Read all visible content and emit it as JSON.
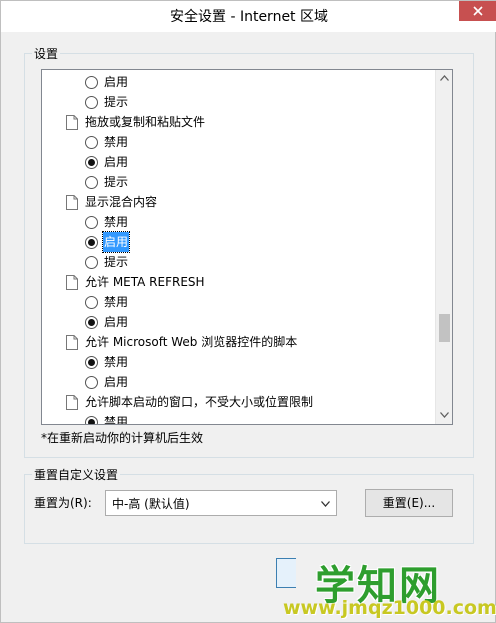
{
  "window": {
    "title": "安全设置 - Internet 区域"
  },
  "settings_group": {
    "label": "设置"
  },
  "list": [
    {
      "kind": "option",
      "label": "启用",
      "checked": false
    },
    {
      "kind": "option",
      "label": "提示",
      "checked": false
    },
    {
      "kind": "header",
      "label": "拖放或复制和粘贴文件"
    },
    {
      "kind": "option",
      "label": "禁用",
      "checked": false
    },
    {
      "kind": "option",
      "label": "启用",
      "checked": true
    },
    {
      "kind": "option",
      "label": "提示",
      "checked": false
    },
    {
      "kind": "header",
      "label": "显示混合内容"
    },
    {
      "kind": "option",
      "label": "禁用",
      "checked": false
    },
    {
      "kind": "option",
      "label": "启用",
      "checked": true,
      "selected": true
    },
    {
      "kind": "option",
      "label": "提示",
      "checked": false
    },
    {
      "kind": "header",
      "label": "允许 META REFRESH"
    },
    {
      "kind": "option",
      "label": "禁用",
      "checked": false
    },
    {
      "kind": "option",
      "label": "启用",
      "checked": true
    },
    {
      "kind": "header",
      "label": "允许 Microsoft Web 浏览器控件的脚本"
    },
    {
      "kind": "option",
      "label": "禁用",
      "checked": true
    },
    {
      "kind": "option",
      "label": "启用",
      "checked": false
    },
    {
      "kind": "header",
      "label": "允许脚本启动的窗口，不受大小或位置限制"
    },
    {
      "kind": "option",
      "label": "禁用",
      "checked": true
    }
  ],
  "note": "*在重新启动你的计算机后生效",
  "reset_group": {
    "label": "重置自定义设置",
    "reset_to_label": "重置为(R):",
    "select_value": "中-高 (默认值)",
    "reset_button": "重置(E)..."
  },
  "watermark": {
    "text": "学知网",
    "url": "www.jmqz1000.com"
  },
  "colors": {
    "selection": "#3399ff",
    "close": "#c75050"
  }
}
